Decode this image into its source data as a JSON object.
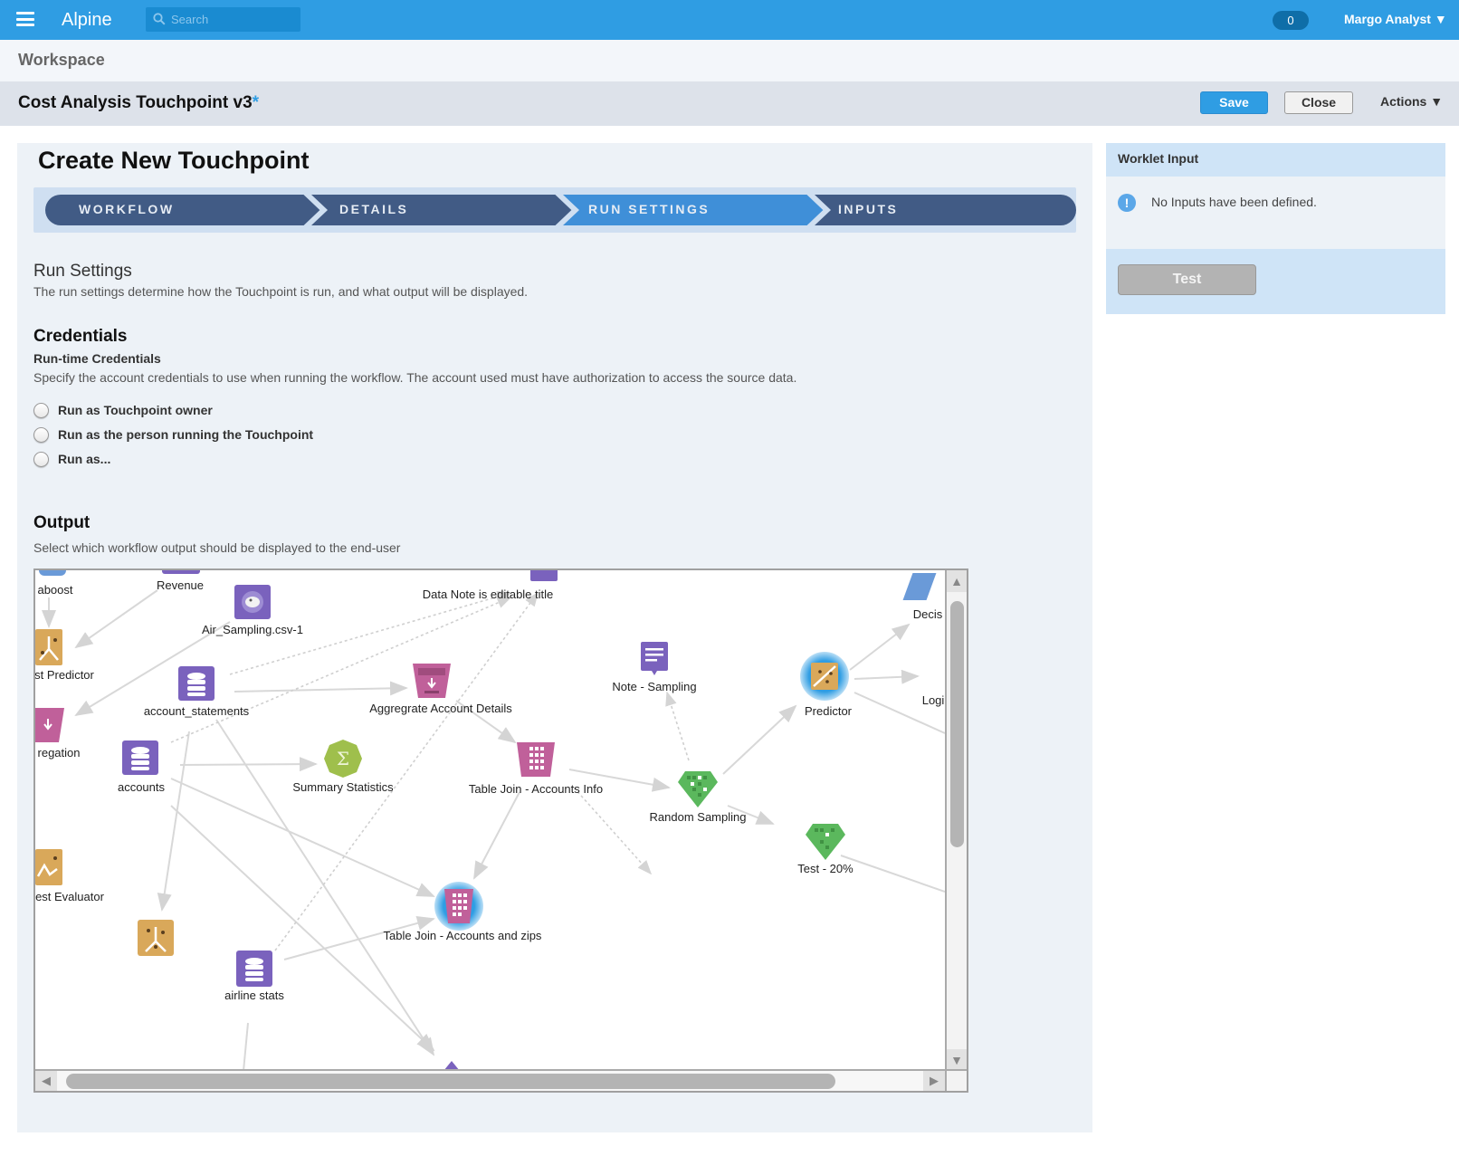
{
  "topbar": {
    "menu_icon": "hamburger-icon",
    "brand": "Alpine",
    "search": {
      "placeholder": "Search",
      "value": "",
      "icon": "search-icon"
    },
    "notification_count": "0",
    "user": "Margo Analyst ▼"
  },
  "breadcrumb": {
    "workspace": "Workspace"
  },
  "document": {
    "title": "Cost Analysis Touchpoint v3",
    "unsaved_marker": "*",
    "save_label": "Save",
    "close_label": "Close",
    "actions_label": "Actions ▼"
  },
  "wizard": {
    "title": "Create New Touchpoint",
    "steps": [
      {
        "label": "WORKFLOW",
        "active": false
      },
      {
        "label": "DETAILS",
        "active": false
      },
      {
        "label": "RUN SETTINGS",
        "active": true
      },
      {
        "label": "INPUTS",
        "active": false
      }
    ],
    "colors": {
      "inactive": "#415b85",
      "active": "#3f8fd8",
      "track": "#cfdff1"
    }
  },
  "run_settings": {
    "title": "Run Settings",
    "description": "The run settings determine how the Touchpoint is run, and what output will be displayed."
  },
  "credentials": {
    "title": "Credentials",
    "subtitle": "Run-time Credentials",
    "description": "Specify the account credentials to use when running the workflow. The account used must have authorization to access the source data.",
    "options": [
      {
        "label": "Run as Touchpoint owner",
        "selected": false
      },
      {
        "label": "Run as the person running the Touchpoint",
        "selected": false
      },
      {
        "label": "Run as...",
        "selected": false
      }
    ]
  },
  "output": {
    "title": "Output",
    "description": "Select which workflow output should be displayed to the end-user",
    "nodes": [
      {
        "label": "aboost",
        "kind": "partial-blue"
      },
      {
        "label": "Revenue",
        "kind": "partial-purple"
      },
      {
        "label": "Air_Sampling.csv-1",
        "kind": "hadoop-dataset"
      },
      {
        "label": "Data Note is editable title",
        "kind": "note"
      },
      {
        "label": "Decis",
        "kind": "decision-tree"
      },
      {
        "label": "st Predictor",
        "kind": "predictor"
      },
      {
        "label": "account_statements",
        "kind": "database"
      },
      {
        "label": "Aggregrate Account Details",
        "kind": "aggregation"
      },
      {
        "label": "Note - Sampling",
        "kind": "note"
      },
      {
        "label": "Predictor",
        "kind": "predictor",
        "highlighted": true
      },
      {
        "label": "Logi",
        "kind": "logistic"
      },
      {
        "label": "regation",
        "kind": "aggregation"
      },
      {
        "label": "accounts",
        "kind": "database"
      },
      {
        "label": "Summary Statistics",
        "kind": "summary-statistics"
      },
      {
        "label": "Table Join - Accounts Info",
        "kind": "join"
      },
      {
        "label": "Random Sampling",
        "kind": "sampling"
      },
      {
        "label": "Test - 20%",
        "kind": "sampling"
      },
      {
        "label": "est Evaluator",
        "kind": "evaluator"
      },
      {
        "label": "",
        "kind": "predictor"
      },
      {
        "label": "Table Join - Accounts and zips",
        "kind": "join",
        "highlighted": true
      },
      {
        "label": "airline stats",
        "kind": "database"
      }
    ]
  },
  "worklet_input": {
    "title": "Worklet Input",
    "message": "No Inputs have been defined.",
    "info_icon": "!",
    "test_label": "Test"
  },
  "scroll": {
    "up": "▲",
    "down": "▼",
    "left": "◀",
    "right": "▶"
  }
}
